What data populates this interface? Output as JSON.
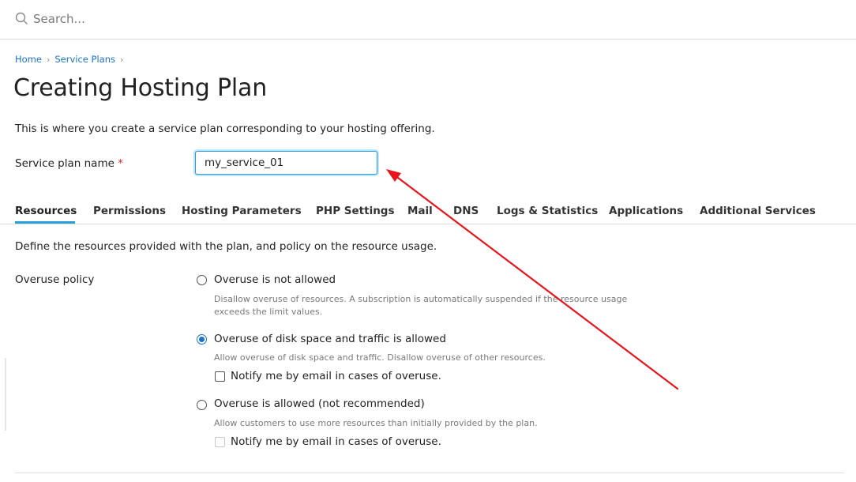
{
  "search": {
    "placeholder": "Search..."
  },
  "breadcrumb": {
    "items": [
      "Home",
      "Service Plans"
    ]
  },
  "page": {
    "title": "Creating Hosting Plan",
    "intro": "This is where you create a service plan corresponding to your hosting offering."
  },
  "form": {
    "plan_name_label": "Service plan name",
    "required_mark": "*",
    "plan_name_value": "my_service_01"
  },
  "tabs": [
    {
      "label": "Resources"
    },
    {
      "label": "Permissions"
    },
    {
      "label": "Hosting Parameters"
    },
    {
      "label": "PHP Settings"
    },
    {
      "label": "Mail"
    },
    {
      "label": "DNS"
    },
    {
      "label": "Logs & Statistics"
    },
    {
      "label": "Applications"
    },
    {
      "label": "Additional Services"
    }
  ],
  "resources": {
    "description": "Define the resources provided with the plan, and policy on the resource usage.",
    "overuse_label": "Overuse policy",
    "options": [
      {
        "label": "Overuse is not allowed",
        "description": "Disallow overuse of resources. A subscription is automatically suspended if the resource usage exceeds the limit values.",
        "selected": false
      },
      {
        "label": "Overuse of disk space and traffic is allowed",
        "description": "Allow overuse of disk space and traffic. Disallow overuse of other resources.",
        "selected": true,
        "notify_label": "Notify me by email in cases of overuse."
      },
      {
        "label": "Overuse is allowed (not recommended)",
        "description": "Allow customers to use more resources than initially provided by the plan.",
        "selected": false,
        "notify_label": "Notify me by email in cases of overuse."
      }
    ]
  },
  "colors": {
    "accent": "#28a0d8",
    "link": "#1b73c7",
    "annotation_arrow": "#e8141b"
  },
  "icons": {
    "search": "search-icon",
    "chevron": "chevron-right-icon"
  }
}
